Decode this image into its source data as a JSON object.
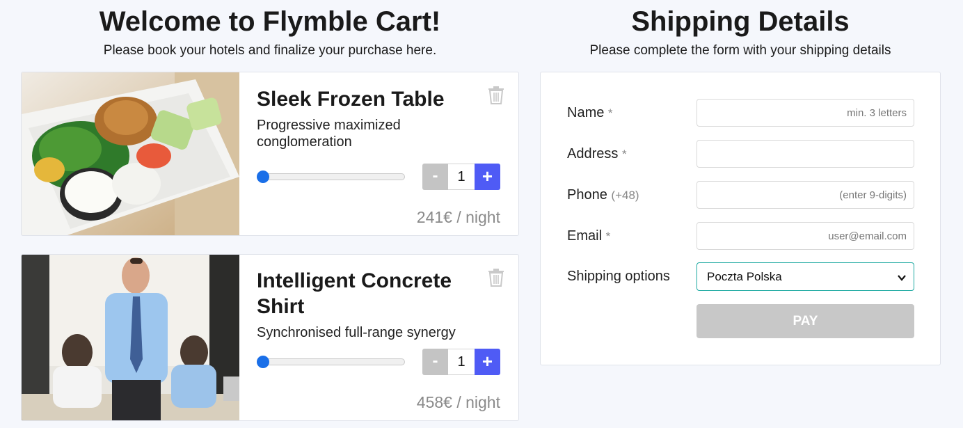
{
  "cart": {
    "title": "Welcome to Flymble Cart!",
    "subtitle": "Please book your hotels and finalize your purchase here.",
    "items": [
      {
        "name": "Sleek Frozen Table",
        "description": "Progressive maximized conglomeration",
        "quantity": "1",
        "minus_label": "-",
        "plus_label": "+",
        "price": "241€ / night",
        "slider_fraction": 0.0,
        "image_icon": "bento-food-photo"
      },
      {
        "name": "Intelligent Concrete Shirt",
        "description": "Synchronised full-range synergy",
        "quantity": "1",
        "minus_label": "-",
        "plus_label": "+",
        "price": "458€ / night",
        "slider_fraction": 0.0,
        "image_icon": "office-people-photo"
      }
    ]
  },
  "shipping": {
    "title": "Shipping Details",
    "subtitle": "Please complete the form with your shipping details",
    "fields": {
      "name": {
        "label": "Name",
        "mark": "*",
        "placeholder": "min. 3 letters",
        "value": ""
      },
      "address": {
        "label": "Address",
        "mark": "*",
        "placeholder": "",
        "value": ""
      },
      "phone": {
        "label": "Phone",
        "mark": "(+48)",
        "placeholder": "(enter 9-digits)",
        "value": ""
      },
      "email": {
        "label": "Email",
        "mark": "*",
        "placeholder": "user@email.com",
        "value": ""
      }
    },
    "shipping_options": {
      "label": "Shipping options",
      "selected": "Poczta Polska"
    },
    "pay_label": "PAY"
  },
  "colors": {
    "accent_blue": "#4f5bf5",
    "slider_thumb": "#1a6fe8",
    "select_border": "#1aa8a0",
    "disabled_gray": "#c8c8c8"
  }
}
